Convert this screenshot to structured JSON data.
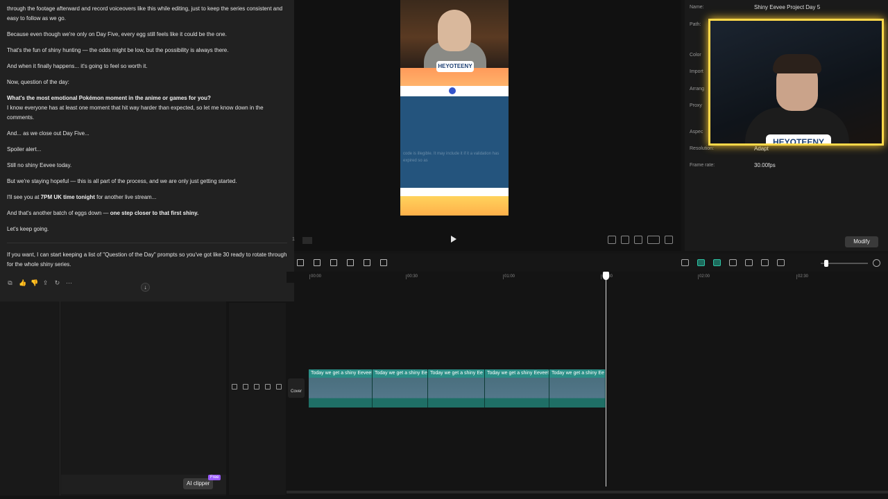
{
  "chat": {
    "paragraphs": [
      "through the footage afterward and record voiceovers like this while editing, just to keep the series consistent and easy to follow as we go.",
      "Because even though we're only on Day Five, every egg still feels like it could be the one.",
      "That's the fun of shiny hunting — the odds might be low, but the possibility is always there.",
      "And when it finally happens... it's going to feel so worth it.",
      "Now, question of the day:"
    ],
    "question_bold": "What's the most emotional Pokémon moment in the anime or games for you?",
    "question_follow": "I know everyone has at least one moment that hit way harder than expected, so let me know down in the comments.",
    "para_close": "And... as we close out Day Five...",
    "spoiler": "Spoiler alert...",
    "no_shiny": "Still no shiny Eevee today.",
    "hopeful": "But we're staying hopeful — this is all part of the process, and we are only just getting started.",
    "see_you_pre": "I'll see you at ",
    "see_you_bold": "7PM UK time tonight",
    "see_you_post": " for another live stream...",
    "eggs_pre": "And that's another batch of eggs down — ",
    "eggs_bold": "one step closer to that first shiny.",
    "keep_going": "Let's keep going.",
    "suggestion": "If you want, I can start keeping a list of \"Question of the Day\" prompts so you've got like 30 ready to rotate through for the whole shiny series.",
    "action_icons": [
      "copy-icon",
      "thumbs-up-icon",
      "thumbs-down-icon",
      "share-icon",
      "regenerate-icon",
      "more-icon"
    ]
  },
  "left_panel": {
    "ai_clipper_label": "AI clipper",
    "free_badge": "Free"
  },
  "preview": {
    "logo_text": "HEYOTEENY",
    "blur_text": "code is illegible. It may include it if it a validation has expired so as",
    "page_marker": "1"
  },
  "properties": {
    "rows": [
      {
        "label": "Name:",
        "value": "Shiny Eevee Project Day 5"
      },
      {
        "label": "Path:",
        "value": ""
      },
      {
        "label": "Color",
        "value": ""
      },
      {
        "label": "Import",
        "value": ""
      },
      {
        "label": "Arrang",
        "value": ""
      },
      {
        "label": "Proxy",
        "value": ""
      },
      {
        "label": "Aspec",
        "value": ""
      },
      {
        "label": "Resolution:",
        "value": "Adapt"
      },
      {
        "label": "Frame rate:",
        "value": "30.00fps"
      }
    ],
    "modify_label": "Modify",
    "webcam_logo": "HEYOTEENY"
  },
  "timeline": {
    "ticks": [
      "00:00",
      "00:30",
      "01:00",
      "01:30",
      "02:00",
      "02:30"
    ],
    "cover_label": "Cover",
    "clips": [
      {
        "label": "Today we get a shiny Eevee!",
        "width": 92
      },
      {
        "label": "Today we get a shiny Ee",
        "width": 80
      },
      {
        "label": "Today we get a shiny Ee",
        "width": 82
      },
      {
        "label": "Today we get a shiny Eevee!",
        "width": 93
      },
      {
        "label": "Today we get a shiny Ee",
        "width": 81
      }
    ]
  }
}
